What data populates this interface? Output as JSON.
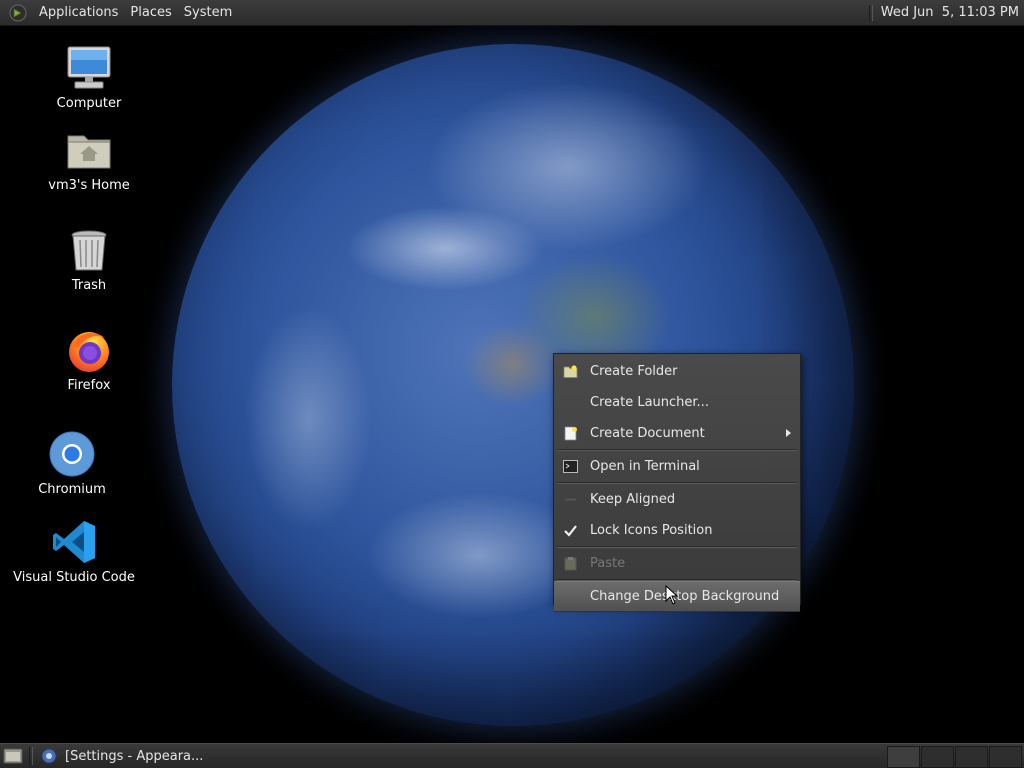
{
  "top_panel": {
    "menus": [
      "Applications",
      "Places",
      "System"
    ],
    "clock": "Wed Jun  5, 11:03 PM"
  },
  "desktop_icons": [
    {
      "label": "Computer",
      "icon": "computer-icon"
    },
    {
      "label": "vm3's Home",
      "icon": "home-folder-icon"
    },
    {
      "label": "Trash",
      "icon": "trash-icon"
    },
    {
      "label": "Firefox",
      "icon": "firefox-icon"
    },
    {
      "label": "Chromium",
      "icon": "chromium-icon"
    },
    {
      "label": "Visual Studio Code",
      "icon": "vscode-icon"
    }
  ],
  "context_menu": {
    "items": [
      {
        "label": "Create Folder",
        "icon": "folder-new-icon",
        "enabled": true
      },
      {
        "label": "Create Launcher...",
        "enabled": true
      },
      {
        "label": "Create Document",
        "icon": "document-new-icon",
        "enabled": true,
        "submenu": true
      },
      {
        "label": "Open in Terminal",
        "icon": "terminal-icon",
        "enabled": true
      },
      {
        "label": "Keep Aligned",
        "enabled": true,
        "checked": false
      },
      {
        "label": "Lock Icons Position",
        "enabled": true,
        "checked": true
      },
      {
        "label": "Paste",
        "icon": "paste-icon",
        "enabled": false
      },
      {
        "label": "Change Desktop Background",
        "enabled": true,
        "highlighted": true
      }
    ]
  },
  "bottom_panel": {
    "task": "[Settings - Appeara...",
    "workspace_count": 4,
    "active_workspace": 1
  },
  "colors": {
    "panel": "#2b2b2b",
    "menu_bg": "#404040",
    "menu_text": "#e8e8e8",
    "disabled_text": "#777777"
  }
}
